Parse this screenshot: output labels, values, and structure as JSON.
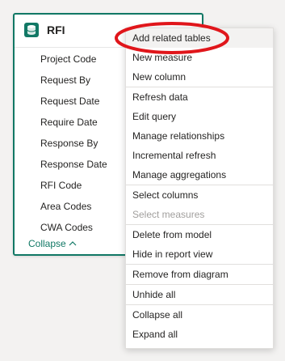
{
  "table": {
    "title": "RFI",
    "icon": "table-icon",
    "fields": [
      "Project Code",
      "Request By",
      "Request Date",
      "Require Date",
      "Response By",
      "Response Date",
      "RFI Code",
      "Area Codes",
      "CWA Codes"
    ],
    "collapse_label": "Collapse",
    "accent_color": "#117865"
  },
  "context_menu": {
    "items": [
      {
        "label": "Add related tables",
        "state": "hover"
      },
      {
        "label": "New measure",
        "state": "normal"
      },
      {
        "label": "New column",
        "state": "normal"
      },
      {
        "label": "Refresh data",
        "state": "normal"
      },
      {
        "label": "Edit query",
        "state": "normal"
      },
      {
        "label": "Manage relationships",
        "state": "normal"
      },
      {
        "label": "Incremental refresh",
        "state": "normal"
      },
      {
        "label": "Manage aggregations",
        "state": "normal"
      },
      {
        "label": "Select columns",
        "state": "normal"
      },
      {
        "label": "Select measures",
        "state": "disabled"
      },
      {
        "label": "Delete from model",
        "state": "normal"
      },
      {
        "label": "Hide in report view",
        "state": "normal"
      },
      {
        "label": "Remove from diagram",
        "state": "normal"
      },
      {
        "label": "Unhide all",
        "state": "normal"
      },
      {
        "label": "Collapse all",
        "state": "normal"
      },
      {
        "label": "Expand all",
        "state": "normal"
      }
    ]
  },
  "annotation": {
    "color": "#e0161b",
    "shape": "ellipse"
  }
}
